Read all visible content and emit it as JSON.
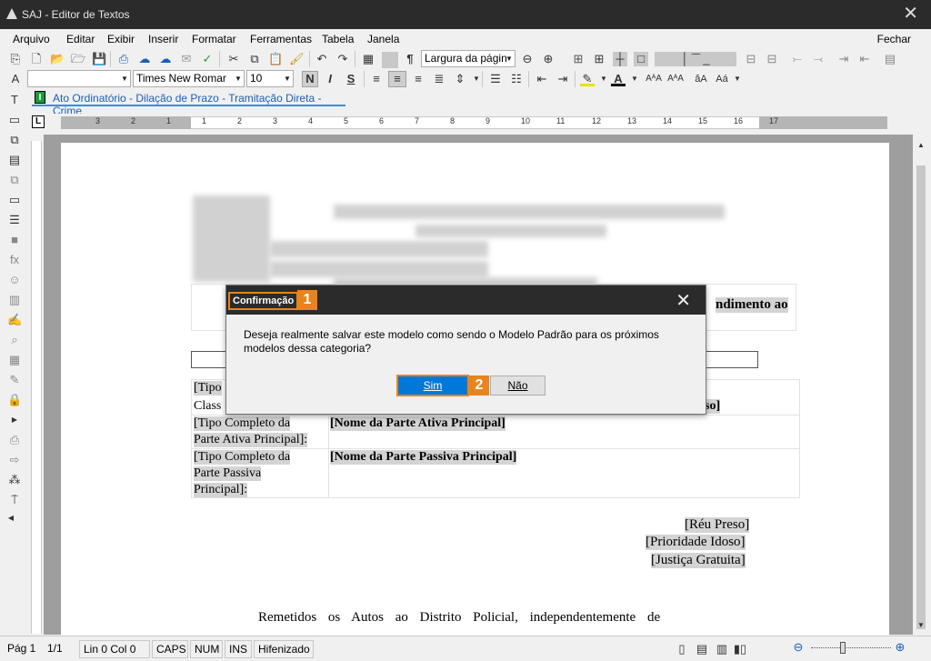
{
  "window": {
    "title": "SAJ - Editor de Textos"
  },
  "menu": {
    "items": [
      "Arquivo",
      "Editar",
      "Exibir",
      "Inserir",
      "Formatar",
      "Ferramentas",
      "Tabela",
      "Janela"
    ],
    "right": "Fechar"
  },
  "toolbar": {
    "zoom_combo": "Largura da págin",
    "font_combo": "Times New Romar",
    "size_combo": "10",
    "bold_label": "N",
    "italic_label": "I",
    "strike_label": "S"
  },
  "category_tab": {
    "badge": "I",
    "label": "Ato Ordinatório - Dilação de Prazo - Tramitação Direta - Crime"
  },
  "ruler": {
    "numbers": [
      "3",
      "2",
      "1",
      "1",
      "2",
      "3",
      "4",
      "5",
      "6",
      "7",
      "8",
      "9",
      "10",
      "11",
      "12",
      "13",
      "14",
      "15",
      "16",
      "17"
    ],
    "corner": "L"
  },
  "document": {
    "header_right": "ndimento ao",
    "row1": "[Tipo",
    "row2": "Class",
    "row2_end": "so]",
    "active_type": "[Tipo Completo da",
    "active_type2": "Parte Ativa Principal]:",
    "active_name": "[Nome da Parte Ativa Principal]",
    "passive_type": "[Tipo Completo da",
    "passive_type2": "Parte Passiva",
    "passive_type3": "Principal]:",
    "passive_name": "[Nome da Parte Passiva Principal]",
    "tag1": "[Réu Preso]",
    "tag2": "[Prioridade Idoso]",
    "tag3": "[Justiça Gratuita]",
    "body": "Remetidos os Autos ao Distrito Policial, independentemente de"
  },
  "dialog": {
    "title": "Confirmação",
    "step1": "1",
    "message": "Deseja realmente salvar este modelo como sendo o Modelo Padrão para os próximos modelos dessa categoria?",
    "yes": "Sim",
    "step2": "2",
    "no": "Não"
  },
  "status": {
    "page": "Pág 1",
    "pages": "1/1",
    "position": "Lin 0  Col 0",
    "caps": "CAPS",
    "num": "NUM",
    "ins": "INS",
    "hyphen": "Hifenizado"
  },
  "colors": {
    "accent": "#0078d7",
    "highlight": "#e8841e",
    "titlebar": "#2b2b2b",
    "tab_underline": "#3b8ed8"
  }
}
